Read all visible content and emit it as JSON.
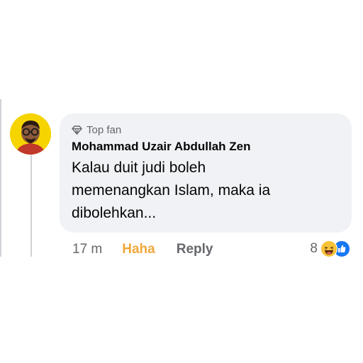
{
  "comment": {
    "badge": "Top fan",
    "author": "Mohammad Uzair Abdullah Zen",
    "text": "Kalau duit judi boleh\nmemenangkan Islam, maka ia\ndibolehkan..."
  },
  "actions": {
    "time": "17 m",
    "reaction_label": "Haha",
    "reply_label": "Reply"
  },
  "reactions": {
    "count": "8",
    "icons": [
      "haha-icon",
      "like-icon"
    ]
  },
  "colors": {
    "bubble": "#f0f2f5",
    "haha": "#f0a73b",
    "like": "#1877f2",
    "secondary_text": "#65676b",
    "avatar_bg": "#f5d400"
  }
}
